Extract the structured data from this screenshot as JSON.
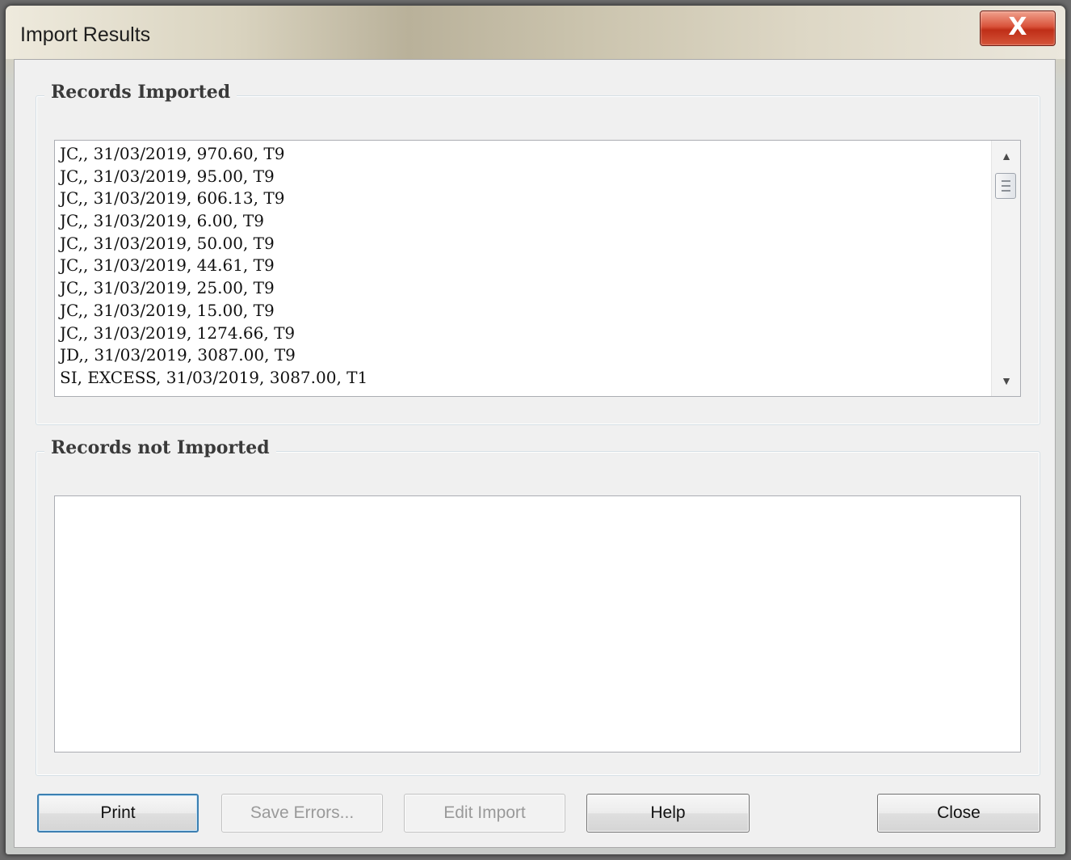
{
  "window": {
    "title": "Import Results",
    "close_glyph": "X"
  },
  "imported": {
    "label": "Records Imported",
    "rows": [
      "JC,, 31/03/2019, 970.60, T9",
      "JC,, 31/03/2019, 95.00, T9",
      "JC,, 31/03/2019, 606.13, T9",
      "JC,, 31/03/2019, 6.00, T9",
      "JC,, 31/03/2019, 50.00, T9",
      "JC,, 31/03/2019, 44.61, T9",
      "JC,, 31/03/2019, 25.00, T9",
      "JC,, 31/03/2019, 15.00, T9",
      "JC,, 31/03/2019, 1274.66, T9",
      "JD,, 31/03/2019, 3087.00, T9",
      "SI, EXCESS, 31/03/2019, 3087.00, T1"
    ]
  },
  "not_imported": {
    "label": "Records not Imported",
    "rows": []
  },
  "buttons": {
    "print": "Print",
    "save_errors": "Save Errors...",
    "edit_import": "Edit Import",
    "help": "Help",
    "close": "Close"
  },
  "icons": {
    "scroll_up": "triangle-up-icon",
    "scroll_down": "triangle-down-icon",
    "close": "close-icon"
  },
  "colors": {
    "close_button": "#c9341e",
    "default_button_border": "#3c7fb1",
    "disabled_text": "#9a9a9a"
  }
}
